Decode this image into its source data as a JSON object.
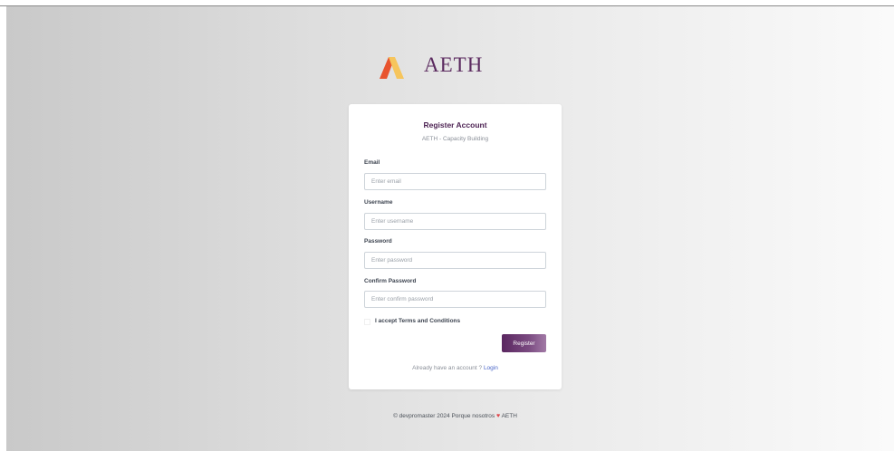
{
  "brand": {
    "name": "AETH",
    "text_color": "#5b2a5f",
    "mark_colors": [
      "#e8542f",
      "#f6c55c"
    ],
    "mark_icon": "aeth-logo-icon"
  },
  "card": {
    "title": "Register Account",
    "subtitle": "AETH - Capacity Building"
  },
  "form": {
    "email": {
      "label": "Email",
      "placeholder": "Enter email",
      "value": ""
    },
    "username": {
      "label": "Username",
      "placeholder": "Enter username",
      "value": ""
    },
    "password": {
      "label": "Password",
      "placeholder": "Enter password",
      "value": ""
    },
    "confirm_password": {
      "label": "Confirm Password",
      "placeholder": "Enter confirm password",
      "value": ""
    },
    "terms": {
      "label": "I accept Terms and Conditions",
      "checked": false
    },
    "submit_label": "Register"
  },
  "login_prompt": {
    "text": "Already have an account ?",
    "link": "Login"
  },
  "footer": {
    "prefix": "© devpromaster 2024 Porque nosotros",
    "heart_icon": "heart-icon",
    "suffix": "AETH"
  },
  "colors": {
    "accent": "#5a2760",
    "link": "#4a66c8",
    "heart": "#e0454a"
  }
}
